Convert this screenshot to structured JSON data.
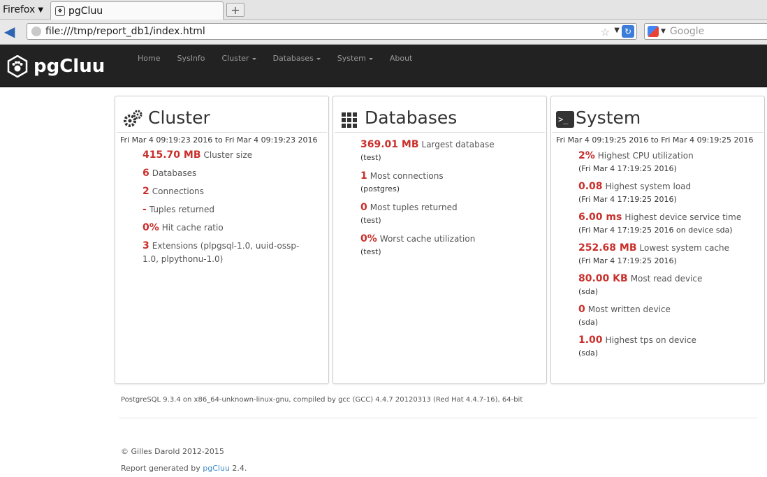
{
  "browser": {
    "menu_label": "Firefox",
    "tab_title": "pgCluu",
    "new_tab_symbol": "+",
    "url": "file:///tmp/report_db1/index.html",
    "search_placeholder": "Google"
  },
  "nav": {
    "brand": "pgCluu",
    "items": [
      {
        "label": "Home",
        "dropdown": false
      },
      {
        "label": "SysInfo",
        "dropdown": false
      },
      {
        "label": "Cluster",
        "dropdown": true
      },
      {
        "label": "Databases",
        "dropdown": true
      },
      {
        "label": "System",
        "dropdown": true
      },
      {
        "label": "About",
        "dropdown": false
      }
    ]
  },
  "cluster": {
    "title": "Cluster",
    "range": "Fri Mar 4 09:19:23 2016 to Fri Mar 4 09:19:23 2016",
    "stats": [
      {
        "value": "415.70 MB",
        "label": "Cluster size"
      },
      {
        "value": "6",
        "label": "Databases"
      },
      {
        "value": "2",
        "label": "Connections"
      },
      {
        "value": "-",
        "label": "Tuples returned"
      },
      {
        "value": "0%",
        "label": "Hit cache ratio"
      },
      {
        "value": "3",
        "label": "Extensions (plpgsql-1.0, uuid-ossp-1.0, plpythonu-1.0)"
      }
    ]
  },
  "databases": {
    "title": "Databases",
    "stats": [
      {
        "value": "369.01 MB",
        "label": "Largest database",
        "sub": "(test)"
      },
      {
        "value": "1",
        "label": "Most connections",
        "sub": "(postgres)"
      },
      {
        "value": "0",
        "label": "Most tuples returned",
        "sub": "(test)"
      },
      {
        "value": "0%",
        "label": "Worst cache utilization",
        "sub": "(test)"
      }
    ]
  },
  "system": {
    "title": "System",
    "range": "Fri Mar 4 09:19:25 2016 to Fri Mar 4 09:19:25 2016",
    "stats": [
      {
        "value": "2%",
        "label": "Highest CPU utilization",
        "sub": "(Fri Mar 4 17:19:25 2016)"
      },
      {
        "value": "0.08",
        "label": "Highest system load",
        "sub": "(Fri Mar 4 17:19:25 2016)"
      },
      {
        "value": "6.00 ms",
        "label": "Highest device service time",
        "sub": "(Fri Mar 4 17:19:25 2016 on device sda)"
      },
      {
        "value": "252.68 MB",
        "label": "Lowest system cache",
        "sub": "(Fri Mar 4 17:19:25 2016)"
      },
      {
        "value": "80.00 KB",
        "label": "Most read device",
        "sub": "(sda)"
      },
      {
        "value": "0",
        "label": "Most written device",
        "sub": "(sda)"
      },
      {
        "value": "1.00",
        "label": "Highest tps on device",
        "sub": "(sda)"
      }
    ]
  },
  "footer": {
    "version": "PostgreSQL 9.3.4 on x86_64-unknown-linux-gnu, compiled by gcc (GCC) 4.4.7 20120313 (Red Hat 4.4.7-16), 64-bit",
    "copyright": "© Gilles Darold 2012-2015",
    "generated_prefix": "Report generated by",
    "generated_link": "pgCluu",
    "generated_version": "2.4."
  },
  "colors": {
    "value_red": "#c9302c",
    "navbar_bg": "#222222",
    "link_blue": "#428bca"
  }
}
